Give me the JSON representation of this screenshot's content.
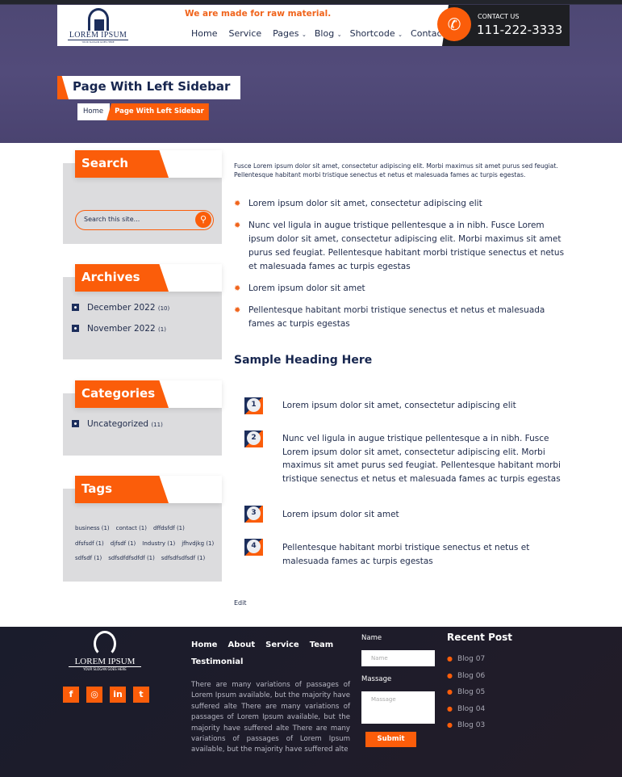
{
  "header": {
    "logo_text": "LOREM IPSUM",
    "logo_slogan": "YOUR SLOGAN GOES HERE",
    "tagline": "We are made for raw material.",
    "nav": [
      {
        "label": "Home"
      },
      {
        "label": "Service"
      },
      {
        "label": "Pages",
        "dropdown": true
      },
      {
        "label": "Blog",
        "dropdown": true
      },
      {
        "label": "Shortcode",
        "dropdown": true
      },
      {
        "label": "Contact"
      }
    ],
    "contact_label": "CONTACT US",
    "phone": "111-222-3333"
  },
  "page": {
    "title": "Page With Left Sidebar",
    "breadcrumb": [
      "Home",
      "Page With Left Sidebar"
    ]
  },
  "sidebar": {
    "search": {
      "title": "Search",
      "placeholder": "Search this site..."
    },
    "archives": {
      "title": "Archives",
      "items": [
        {
          "label": "December 2022",
          "count": "(10)"
        },
        {
          "label": "November 2022",
          "count": "(1)"
        }
      ]
    },
    "categories": {
      "title": "Categories",
      "items": [
        {
          "label": "Uncategorized",
          "count": "(11)"
        }
      ]
    },
    "tags": {
      "title": "Tags",
      "items": [
        "business (1)",
        "contact (1)",
        "dffdsfdf (1)",
        "dfsfsdf (1)",
        "djfsdf (1)",
        "Industry (1)",
        "jfhvdjkg (1)",
        "sdfsdf (1)",
        "sdfsdfdfsdfdf (1)",
        "sdfsdfsdfsdf (1)"
      ]
    }
  },
  "content": {
    "intro": "Fusce Lorem ipsum dolor sit amet, consectetur adipiscing elit. Morbi maximus sit amet purus sed feugiat. Pellentesque habitant morbi tristique senectus et netus et malesuada fames ac turpis egestas.",
    "bullets": [
      "Lorem ipsum dolor sit amet, consectetur adipiscing elit",
      "Nunc vel ligula in augue tristique pellentesque a in nibh. Fusce Lorem ipsum dolor sit amet, consectetur adipiscing elit. Morbi maximus sit amet purus sed feugiat. Pellentesque habitant morbi tristique senectus et netus et malesuada fames ac turpis egestas",
      "Lorem ipsum dolor sit amet",
      "Pellentesque habitant morbi tristique senectus et netus et malesuada fames ac turpis egestas"
    ],
    "heading": "Sample Heading Here",
    "numbered": [
      {
        "n": "1",
        "text": "Lorem ipsum dolor sit amet, consectetur adipiscing elit"
      },
      {
        "n": "2",
        "text": "Nunc vel ligula in augue tristique pellentesque a in nibh. Fusce Lorem ipsum dolor sit amet, consectetur adipiscing elit. Morbi maximus sit amet purus sed feugiat. Pellentesque habitant morbi tristique senectus et netus et malesuada fames ac turpis egestas"
      },
      {
        "n": "3",
        "text": "Lorem ipsum dolor sit amet"
      },
      {
        "n": "4",
        "text": "Pellentesque habitant morbi tristique senectus et netus et malesuada fames ac turpis egestas"
      }
    ],
    "edit": "Edit"
  },
  "footer": {
    "logo_text": "LOREM IPSUM",
    "logo_slogan": "YOUR SLOGAN GOES HERE",
    "social": [
      "facebook",
      "instagram",
      "linkedin",
      "twitter"
    ],
    "links": [
      "Home",
      "About",
      "Service",
      "Team",
      "Testimonial"
    ],
    "text": "There are many variations of passages of Lorem Ipsum available, but the majority have suffered alte There are many variations of passages of Lorem Ipsum available, but the majority have suffered alte There are many variations of passages of Lorem Ipsum available, but the majority have suffered alte",
    "form": {
      "name_label": "Name",
      "name_placeholder": "Name",
      "message_label": "Massage",
      "message_placeholder": "Massage",
      "submit": "Submit"
    },
    "recent_title": "Recent Post",
    "recent": [
      "Blog 07",
      "Blog 06",
      "Blog 05",
      "Blog 04",
      "Blog 03"
    ]
  },
  "colors": {
    "accent": "#fb5d0a",
    "navy": "#17264f",
    "footer_bg": "#1a1c2c"
  }
}
